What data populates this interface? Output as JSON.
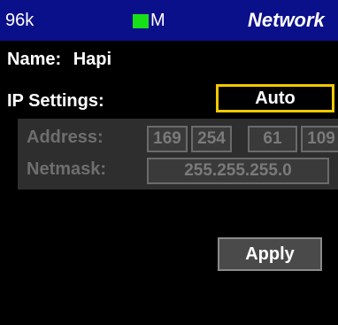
{
  "header": {
    "sample_rate": "96k",
    "status_letter": "M",
    "status_color": "#18e018",
    "title": "Network",
    "background": "#0a0f8a"
  },
  "device": {
    "name_label": "Name:",
    "name_value": "Hapi"
  },
  "ip_settings": {
    "label": "IP Settings:",
    "mode_value": "Auto",
    "highlight_color": "#f3c800"
  },
  "address": {
    "label": "Address:",
    "octets": [
      "169",
      "254",
      "61",
      "109"
    ]
  },
  "netmask": {
    "label": "Netmask:",
    "value": "255.255.255.0"
  },
  "actions": {
    "apply_label": "Apply"
  }
}
